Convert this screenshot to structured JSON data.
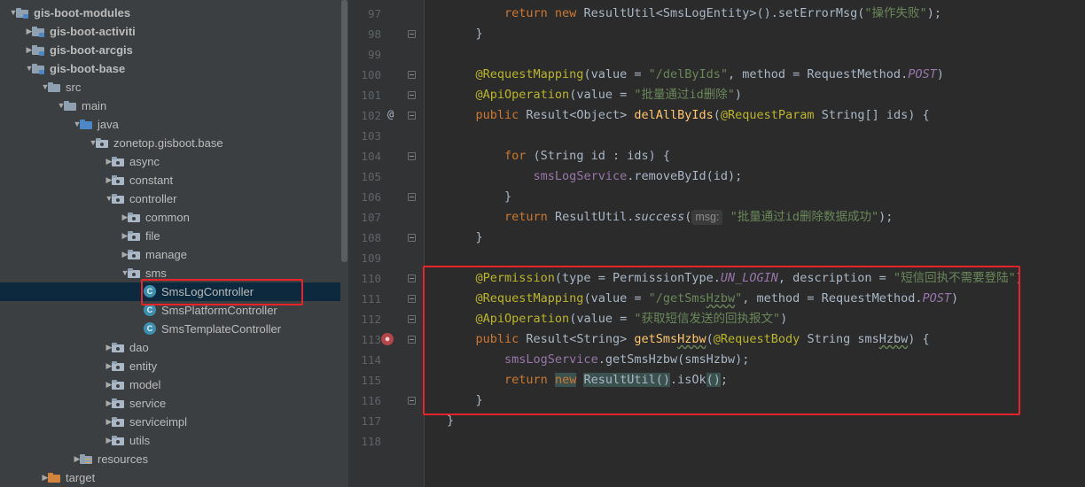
{
  "tree": {
    "items": [
      {
        "label": "gis-boot-modules",
        "indent": 0,
        "arrow": "down",
        "icon": "module",
        "bold": true
      },
      {
        "label": "gis-boot-activiti",
        "indent": 1,
        "arrow": "right",
        "icon": "module",
        "bold": true
      },
      {
        "label": "gis-boot-arcgis",
        "indent": 1,
        "arrow": "right",
        "icon": "module",
        "bold": true
      },
      {
        "label": "gis-boot-base",
        "indent": 1,
        "arrow": "down",
        "icon": "module",
        "bold": true
      },
      {
        "label": "src",
        "indent": 2,
        "arrow": "down",
        "icon": "folder"
      },
      {
        "label": "main",
        "indent": 3,
        "arrow": "down",
        "icon": "folder"
      },
      {
        "label": "java",
        "indent": 4,
        "arrow": "down",
        "icon": "srcfolder"
      },
      {
        "label": "zonetop.gisboot.base",
        "indent": 5,
        "arrow": "down",
        "icon": "pkg"
      },
      {
        "label": "async",
        "indent": 6,
        "arrow": "right",
        "icon": "pkg"
      },
      {
        "label": "constant",
        "indent": 6,
        "arrow": "right",
        "icon": "pkg"
      },
      {
        "label": "controller",
        "indent": 6,
        "arrow": "down",
        "icon": "pkg"
      },
      {
        "label": "common",
        "indent": 7,
        "arrow": "right",
        "icon": "pkg"
      },
      {
        "label": "file",
        "indent": 7,
        "arrow": "right",
        "icon": "pkg"
      },
      {
        "label": "manage",
        "indent": 7,
        "arrow": "right",
        "icon": "pkg"
      },
      {
        "label": "sms",
        "indent": 7,
        "arrow": "down",
        "icon": "pkg"
      },
      {
        "label": "SmsLogController",
        "indent": 8,
        "arrow": "",
        "icon": "class",
        "selected": true
      },
      {
        "label": "SmsPlatformController",
        "indent": 8,
        "arrow": "",
        "icon": "class"
      },
      {
        "label": "SmsTemplateController",
        "indent": 8,
        "arrow": "",
        "icon": "class"
      },
      {
        "label": "dao",
        "indent": 6,
        "arrow": "right",
        "icon": "pkg"
      },
      {
        "label": "entity",
        "indent": 6,
        "arrow": "right",
        "icon": "pkg"
      },
      {
        "label": "model",
        "indent": 6,
        "arrow": "right",
        "icon": "pkg"
      },
      {
        "label": "service",
        "indent": 6,
        "arrow": "right",
        "icon": "pkg"
      },
      {
        "label": "serviceimpl",
        "indent": 6,
        "arrow": "right",
        "icon": "pkg"
      },
      {
        "label": "utils",
        "indent": 6,
        "arrow": "right",
        "icon": "pkg"
      },
      {
        "label": "resources",
        "indent": 4,
        "arrow": "right",
        "icon": "resfolder"
      },
      {
        "label": "target",
        "indent": 2,
        "arrow": "right",
        "icon": "target"
      }
    ]
  },
  "editor": {
    "class_icon_letter": "C",
    "lines": [
      {
        "num": "97",
        "fold": false,
        "tokens": [
          [
            "",
            "        "
          ],
          [
            "kw",
            "return new "
          ],
          [
            "",
            "ResultUtil<SmsLogEntity>().setErrorMsg("
          ],
          [
            "st",
            "\"操作失败\""
          ],
          [
            "",
            ");"
          ]
        ]
      },
      {
        "num": "98",
        "fold": true,
        "tokens": [
          [
            "",
            "    }"
          ]
        ]
      },
      {
        "num": "99",
        "fold": false,
        "tokens": []
      },
      {
        "num": "100",
        "fold": true,
        "tokens": [
          [
            "",
            "    "
          ],
          [
            "an",
            "@RequestMapping"
          ],
          [
            "",
            "(value = "
          ],
          [
            "st",
            "\"/delByIds\""
          ],
          [
            "",
            ", method = RequestMethod."
          ],
          [
            "it",
            "POST"
          ],
          [
            "",
            ")"
          ]
        ]
      },
      {
        "num": "101",
        "fold": true,
        "tokens": [
          [
            "",
            "    "
          ],
          [
            "an",
            "@ApiOperation"
          ],
          [
            "",
            "(value = "
          ],
          [
            "st",
            "\"批量通过id删除\""
          ],
          [
            "",
            ")"
          ]
        ]
      },
      {
        "num": "102",
        "fold": true,
        "mark": "@",
        "tokens": [
          [
            "",
            "    "
          ],
          [
            "kw",
            "public "
          ],
          [
            "",
            "Result<Object> "
          ],
          [
            "mt",
            "delAllByIds"
          ],
          [
            "",
            "("
          ],
          [
            "an",
            "@RequestParam "
          ],
          [
            "",
            "String[] ids) {"
          ]
        ]
      },
      {
        "num": "103",
        "fold": false,
        "tokens": []
      },
      {
        "num": "104",
        "fold": true,
        "tokens": [
          [
            "",
            "        "
          ],
          [
            "kw",
            "for "
          ],
          [
            "",
            "(String id : ids) {"
          ]
        ]
      },
      {
        "num": "105",
        "fold": false,
        "tokens": [
          [
            "",
            "            "
          ],
          [
            "fd",
            "smsLogService"
          ],
          [
            "",
            ".removeById(id);"
          ]
        ]
      },
      {
        "num": "106",
        "fold": true,
        "tokens": [
          [
            "",
            "        }"
          ]
        ]
      },
      {
        "num": "107",
        "fold": false,
        "tokens": [
          [
            "",
            "        "
          ],
          [
            "kw",
            "return "
          ],
          [
            "",
            "ResultUtil."
          ],
          [
            "sm",
            "success"
          ],
          [
            "",
            "("
          ],
          [
            "hint",
            "msg:"
          ],
          [
            "",
            " "
          ],
          [
            "st",
            "\"批量通过id删除数据成功\""
          ],
          [
            "",
            ");"
          ]
        ]
      },
      {
        "num": "108",
        "fold": true,
        "tokens": [
          [
            "",
            "    }"
          ]
        ]
      },
      {
        "num": "109",
        "fold": false,
        "tokens": []
      },
      {
        "num": "110",
        "fold": true,
        "tokens": [
          [
            "",
            "    "
          ],
          [
            "an",
            "@Permission"
          ],
          [
            "",
            "(type = PermissionType."
          ],
          [
            "it",
            "UN_LOGIN"
          ],
          [
            "",
            ", description = "
          ],
          [
            "st",
            "\"短信回执不需要登陆\""
          ],
          [
            "",
            ")"
          ]
        ]
      },
      {
        "num": "111",
        "fold": true,
        "tokens": [
          [
            "",
            "    "
          ],
          [
            "an",
            "@RequestMapping"
          ],
          [
            "",
            "(value = "
          ],
          [
            "st",
            "\"/getSms"
          ],
          [
            "stw",
            "Hzbw"
          ],
          [
            "st",
            "\""
          ],
          [
            "",
            ", method = RequestMethod."
          ],
          [
            "it",
            "POST"
          ],
          [
            "",
            ")"
          ]
        ]
      },
      {
        "num": "112",
        "fold": true,
        "tokens": [
          [
            "",
            "    "
          ],
          [
            "an",
            "@ApiOperation"
          ],
          [
            "",
            "(value = "
          ],
          [
            "st",
            "\"获取短信发送的回执报文\""
          ],
          [
            "",
            ")"
          ]
        ]
      },
      {
        "num": "113",
        "fold": true,
        "mark": "red",
        "tokens": [
          [
            "",
            "    "
          ],
          [
            "kw",
            "public "
          ],
          [
            "",
            "Result<String> "
          ],
          [
            "mt",
            "getSms"
          ],
          [
            "mtw",
            "Hzbw"
          ],
          [
            "",
            "("
          ],
          [
            "an",
            "@RequestBody "
          ],
          [
            "",
            "String sms"
          ],
          [
            "w",
            "Hzbw"
          ],
          [
            "",
            ") {"
          ]
        ]
      },
      {
        "num": "114",
        "fold": false,
        "tokens": [
          [
            "",
            "        "
          ],
          [
            "fd",
            "smsLogService"
          ],
          [
            "",
            ".getSmsHzbw(smsHzbw);"
          ]
        ]
      },
      {
        "num": "115",
        "fold": false,
        "tokens": [
          [
            "",
            "        "
          ],
          [
            "kwh",
            "return "
          ],
          [
            "kwhl",
            "new"
          ],
          [
            "",
            " "
          ],
          [
            "hl",
            "ResultUtil()"
          ],
          [
            "",
            ".isOk"
          ],
          [
            "hl",
            "()"
          ],
          [
            "",
            ";"
          ]
        ]
      },
      {
        "num": "116",
        "fold": true,
        "tokens": [
          [
            "",
            "    }"
          ]
        ]
      },
      {
        "num": "117",
        "fold": false,
        "tokens": [
          [
            "",
            "}"
          ]
        ]
      },
      {
        "num": "118",
        "fold": false,
        "tokens": []
      }
    ]
  }
}
